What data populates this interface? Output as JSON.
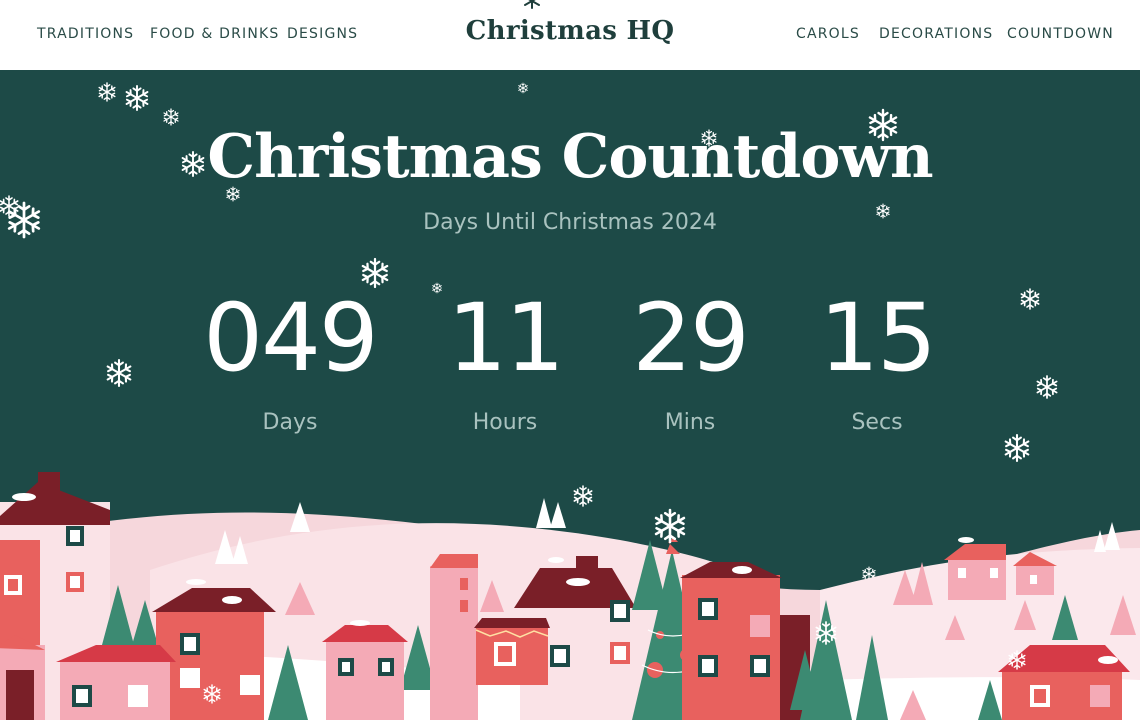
{
  "nav": {
    "left": [
      "TRADITIONS",
      "FOOD & DRINKS",
      "DESIGNS"
    ],
    "brand": "Christmas HQ",
    "right": [
      "CAROLS",
      "DECORATIONS",
      "COUNTDOWN"
    ]
  },
  "hero": {
    "title": "Christmas Countdown",
    "subtitle": "Days Until Christmas 2024"
  },
  "countdown": {
    "days": "049",
    "days_label": "Days",
    "hours": "11",
    "hours_label": "Hours",
    "mins": "29",
    "mins_label": "Mins",
    "secs": "15",
    "secs_label": "Secs"
  },
  "colors": {
    "hero_bg": "#1d4a47",
    "nav_text": "#2a4b47",
    "house_red": "#e8615e",
    "roof_dark": "#7a1f28",
    "tree_green": "#3c8a72",
    "snow_pink": "#f6d7dc"
  },
  "icons": {
    "brand": "snowflake-icon",
    "background": "snowflake-icon"
  }
}
